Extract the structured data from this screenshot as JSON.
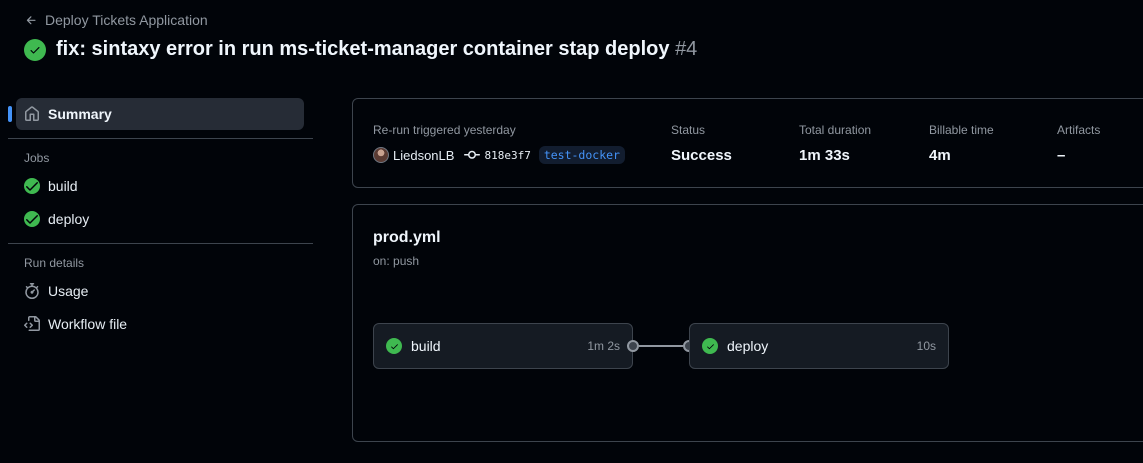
{
  "header": {
    "back_label": "Deploy Tickets Application",
    "title": "fix: sintaxy error in run ms-ticket-manager container stap deploy",
    "run_number": "#4"
  },
  "sidebar": {
    "summary_label": "Summary",
    "jobs_heading": "Jobs",
    "jobs": [
      {
        "label": "build",
        "icon": "check-circle-icon"
      },
      {
        "label": "deploy",
        "icon": "check-circle-icon"
      }
    ],
    "run_details_heading": "Run details",
    "run_details": [
      {
        "label": "Usage",
        "icon": "stopwatch-icon"
      },
      {
        "label": "Workflow file",
        "icon": "file-code-icon"
      }
    ]
  },
  "run_summary": {
    "trigger_label": "Re-run triggered yesterday",
    "actor": "LiedsonLB",
    "commit": "818e3f7",
    "branch": "test-docker",
    "status_label": "Status",
    "status_value": "Success",
    "duration_label": "Total duration",
    "duration_value": "1m 33s",
    "billable_label": "Billable time",
    "billable_value": "4m",
    "artifacts_label": "Artifacts",
    "artifacts_value": "–"
  },
  "workflow": {
    "file": "prod.yml",
    "trigger": "on: push",
    "jobs": [
      {
        "name": "build",
        "duration": "1m 2s",
        "status": "success"
      },
      {
        "name": "deploy",
        "duration": "10s",
        "status": "success"
      }
    ]
  },
  "colors": {
    "success": "#3fb950",
    "accent": "#4493f8",
    "background": "#010409"
  }
}
